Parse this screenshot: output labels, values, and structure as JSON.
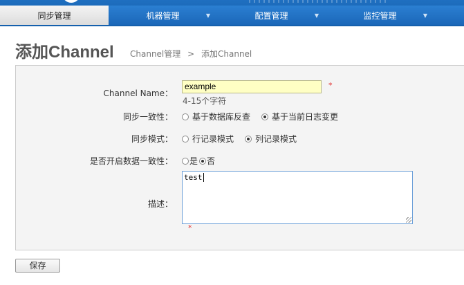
{
  "nav": {
    "tabs": [
      {
        "label": "同步管理",
        "active": true,
        "dropdown": false
      },
      {
        "label": "机器管理",
        "active": false,
        "dropdown": true
      },
      {
        "label": "配置管理",
        "active": false,
        "dropdown": true
      },
      {
        "label": "监控管理",
        "active": false,
        "dropdown": true
      }
    ],
    "caret": "▼"
  },
  "header": {
    "title": "添加Channel",
    "breadcrumb": {
      "parent": "Channel管理",
      "separator": ">",
      "current": "添加Channel"
    }
  },
  "form": {
    "name": {
      "label": "Channel Name：",
      "value": "example",
      "required_mark": "*",
      "hint": "4-15个字符"
    },
    "consistency": {
      "label": "同步一致性：",
      "options": [
        {
          "label": "基于数据库反查",
          "checked": false
        },
        {
          "label": "基于当前日志变更",
          "checked": true
        }
      ]
    },
    "mode": {
      "label": "同步模式：",
      "options": [
        {
          "label": "行记录模式",
          "checked": false
        },
        {
          "label": "列记录模式",
          "checked": true
        }
      ]
    },
    "data_consistency": {
      "label": "是否开启数据一致性：",
      "options": [
        {
          "label": "是",
          "checked": false
        },
        {
          "label": "否",
          "checked": true
        }
      ]
    },
    "description": {
      "label": "描述：",
      "value": "test",
      "required_mark": "*"
    }
  },
  "actions": {
    "save_label": "保存"
  },
  "colors": {
    "nav_blue": "#1b67b8",
    "input_highlight": "#ffffc4",
    "required_red": "#e0302f"
  }
}
